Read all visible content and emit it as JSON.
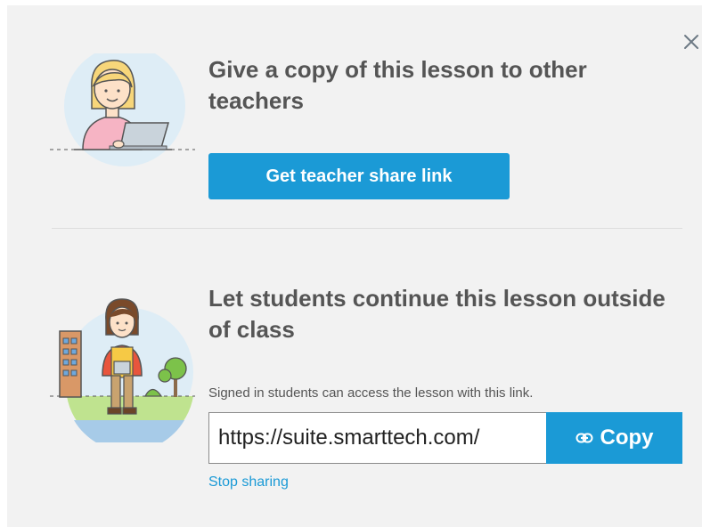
{
  "dialog": {
    "close_icon": "close-icon",
    "teacher_section": {
      "title": "Give a copy of this lesson to other teachers",
      "button_label": "Get teacher share link",
      "illustration": "teacher-with-laptop-illustration"
    },
    "student_section": {
      "title": "Let students continue this lesson outside of class",
      "helper_text": "Signed in students can access the lesson with this link.",
      "link_value": "https://suite.smarttech.com/",
      "copy_label": "Copy",
      "copy_icon": "link-icon",
      "stop_label": "Stop sharing",
      "illustration": "student-with-tablet-illustration"
    }
  },
  "colors": {
    "accent": "#1b9ad6",
    "panel_bg": "#f2f2f2",
    "title_text": "#555555"
  }
}
